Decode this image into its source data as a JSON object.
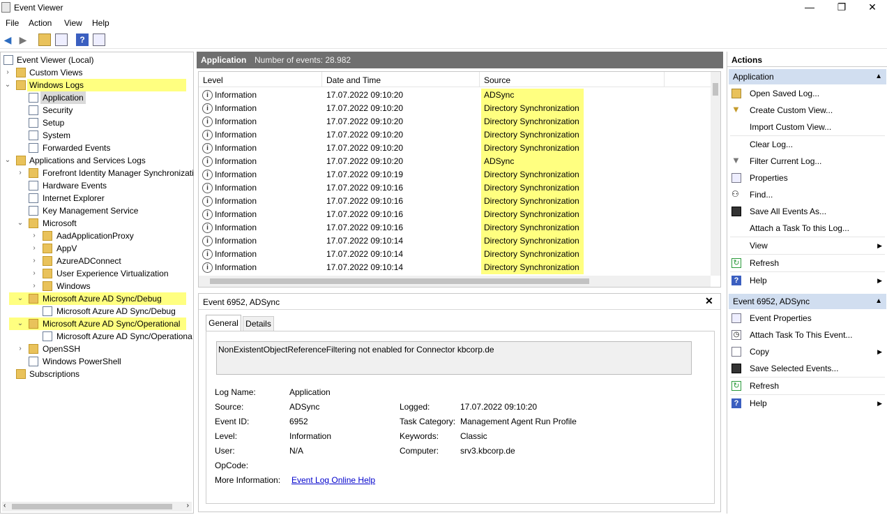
{
  "window": {
    "title": "Event Viewer",
    "minimize": "—",
    "maximize": "❐",
    "close": "✕"
  },
  "menu": [
    "File",
    "Action",
    "View",
    "Help"
  ],
  "tree": {
    "root": "Event Viewer (Local)",
    "custom_views": "Custom Views",
    "windows_logs": "Windows Logs",
    "application": "Application",
    "security": "Security",
    "setup": "Setup",
    "system": "System",
    "forwarded": "Forwarded Events",
    "apps_services": "Applications and Services Logs",
    "fim": "Forefront Identity Manager Synchronizati",
    "hardware": "Hardware Events",
    "ie": "Internet Explorer",
    "kms": "Key Management Service",
    "microsoft": "Microsoft",
    "aadproxy": "AadApplicationProxy",
    "appv": "AppV",
    "azureadconnect": "AzureADConnect",
    "uev": "User Experience Virtualization",
    "windows": "Windows",
    "aad_debug_folder": "Microsoft Azure AD Sync/Debug",
    "aad_debug_log": "Microsoft Azure AD Sync/Debug",
    "aad_oper_folder": "Microsoft Azure AD Sync/Operational",
    "aad_oper_log": "Microsoft Azure AD Sync/Operationa",
    "openssh": "OpenSSH",
    "powershell": "Windows PowerShell",
    "subscriptions": "Subscriptions"
  },
  "center": {
    "title": "Application",
    "count": "Number of events: 28.982"
  },
  "grid": {
    "headers": [
      "Level",
      "Date and Time",
      "Source"
    ],
    "rows": [
      [
        "Information",
        "17.07.2022 09:10:20",
        "ADSync"
      ],
      [
        "Information",
        "17.07.2022 09:10:20",
        "Directory Synchronization"
      ],
      [
        "Information",
        "17.07.2022 09:10:20",
        "Directory Synchronization"
      ],
      [
        "Information",
        "17.07.2022 09:10:20",
        "Directory Synchronization"
      ],
      [
        "Information",
        "17.07.2022 09:10:20",
        "Directory Synchronization"
      ],
      [
        "Information",
        "17.07.2022 09:10:20",
        "ADSync"
      ],
      [
        "Information",
        "17.07.2022 09:10:19",
        "Directory Synchronization"
      ],
      [
        "Information",
        "17.07.2022 09:10:16",
        "Directory Synchronization"
      ],
      [
        "Information",
        "17.07.2022 09:10:16",
        "Directory Synchronization"
      ],
      [
        "Information",
        "17.07.2022 09:10:16",
        "Directory Synchronization"
      ],
      [
        "Information",
        "17.07.2022 09:10:16",
        "Directory Synchronization"
      ],
      [
        "Information",
        "17.07.2022 09:10:14",
        "Directory Synchronization"
      ],
      [
        "Information",
        "17.07.2022 09:10:14",
        "Directory Synchronization"
      ],
      [
        "Information",
        "17.07.2022 09:10:14",
        "Directory Synchronization"
      ]
    ]
  },
  "detail": {
    "title": "Event 6952, ADSync",
    "tab_general": "General",
    "tab_details": "Details",
    "message": "NonExistentObjectReferenceFiltering not enabled for Connector kbcorp.de",
    "log_name_label": "Log Name:",
    "log_name": "Application",
    "source_label": "Source:",
    "source": "ADSync",
    "logged_label": "Logged:",
    "logged": "17.07.2022 09:10:20",
    "event_id_label": "Event ID:",
    "event_id": "6952",
    "task_label": "Task Category:",
    "task": "Management Agent Run Profile",
    "level_label": "Level:",
    "level": "Information",
    "keywords_label": "Keywords:",
    "keywords": "Classic",
    "user_label": "User:",
    "user": "N/A",
    "computer_label": "Computer:",
    "computer": "srv3.kbcorp.de",
    "opcode_label": "OpCode:",
    "more_label": "More Information:",
    "more_link": "Event Log Online Help"
  },
  "actions": {
    "header": "Actions",
    "sect1": "Application",
    "open_saved": "Open Saved Log...",
    "create_custom": "Create Custom View...",
    "import_custom": "Import Custom View...",
    "clear_log": "Clear Log...",
    "filter": "Filter Current Log...",
    "properties": "Properties",
    "find": "Find...",
    "save_all": "Save All Events As...",
    "attach_log": "Attach a Task To this Log...",
    "view": "View",
    "refresh1": "Refresh",
    "help1": "Help",
    "sect2": "Event 6952, ADSync",
    "event_props": "Event Properties",
    "attach_event": "Attach Task To This Event...",
    "copy": "Copy",
    "save_selected": "Save Selected Events...",
    "refresh2": "Refresh",
    "help2": "Help"
  },
  "colors": {
    "highlight": "#ffff80",
    "section": "#d1def0",
    "header_bar": "#6f6f6f",
    "link": "#0000cc"
  }
}
